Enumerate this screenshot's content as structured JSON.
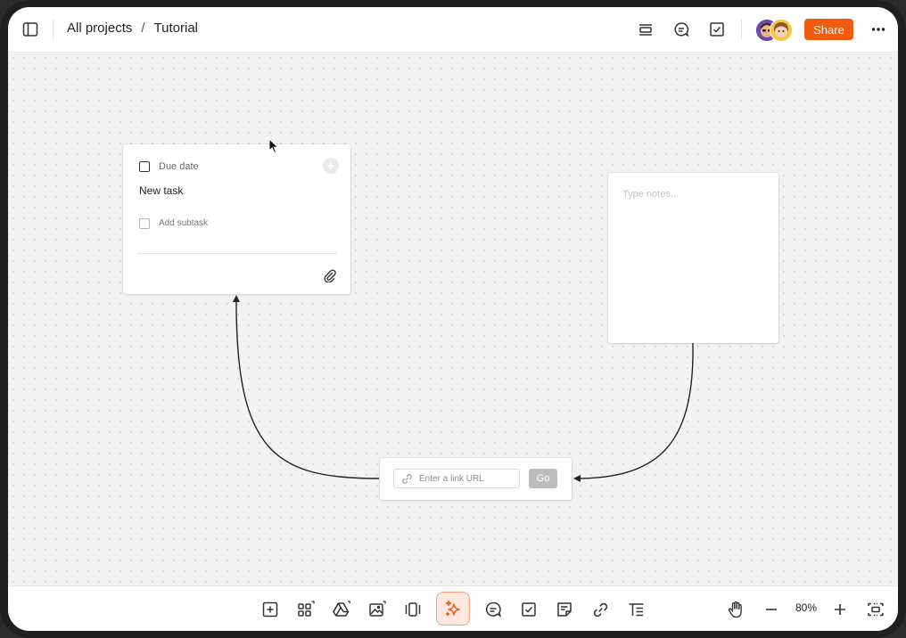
{
  "header": {
    "breadcrumb": {
      "root": "All projects",
      "separator": "/",
      "current": "Tutorial"
    },
    "share_label": "Share",
    "icons": {
      "sidebar_toggle": "sidebar-panel-icon",
      "present": "present-icon",
      "comments": "comment-icon",
      "tasks": "task-check-icon",
      "more": "more-horizontal-icon"
    }
  },
  "canvas": {
    "task_card": {
      "due_date_label": "Due date",
      "title": "New task",
      "subtask_label": "Add subtask"
    },
    "note_card": {
      "placeholder": "Type notes..."
    },
    "link_card": {
      "url_placeholder": "Enter a link URL",
      "go_label": "Go"
    }
  },
  "toolbar": {
    "tools": [
      "add-block-icon",
      "apps-grid-icon",
      "google-drive-icon",
      "image-icon",
      "carousel-icon",
      "ai-sparkle-icon",
      "comment-icon",
      "task-check-icon",
      "note-icon",
      "link-icon",
      "text-format-icon"
    ],
    "zoom_level": "80%"
  },
  "colors": {
    "accent": "#f25a0e",
    "ai_highlight_bg": "#fde9df",
    "canvas_bg": "#f3f3f3",
    "go_button": "#bdbdbd"
  }
}
